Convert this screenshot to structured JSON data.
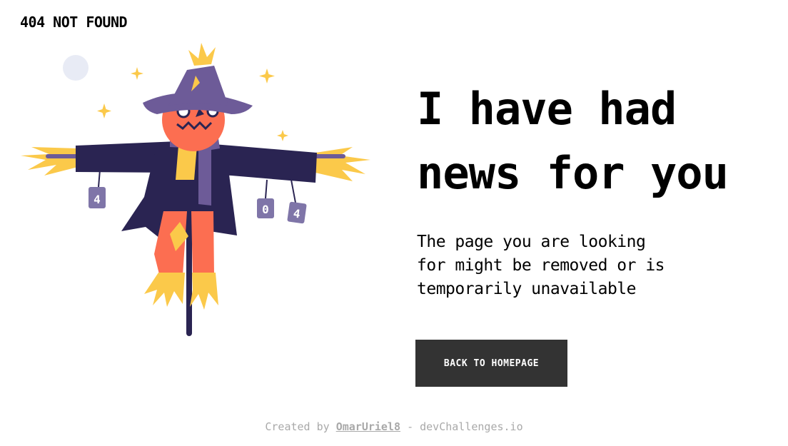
{
  "header": {
    "brand": "404 NOT FOUND"
  },
  "illustration": {
    "can_labels": [
      "4",
      "0",
      "4"
    ]
  },
  "main": {
    "headline": "I have had news for you",
    "message": "The page you are looking for might be removed or is temporarily unavailable",
    "button_label": "BACK TO HOMEPAGE"
  },
  "footer": {
    "created_by": "Created by",
    "author": "OmarUriel8",
    "separator": "-",
    "site": "devChallenges.io"
  },
  "colors": {
    "ink": "#2a2452",
    "hat": "#6d5b98",
    "pumpkin": "#fc6e51",
    "straw": "#fbc94a",
    "button": "#333333",
    "footer_text": "#a9a9a9"
  }
}
